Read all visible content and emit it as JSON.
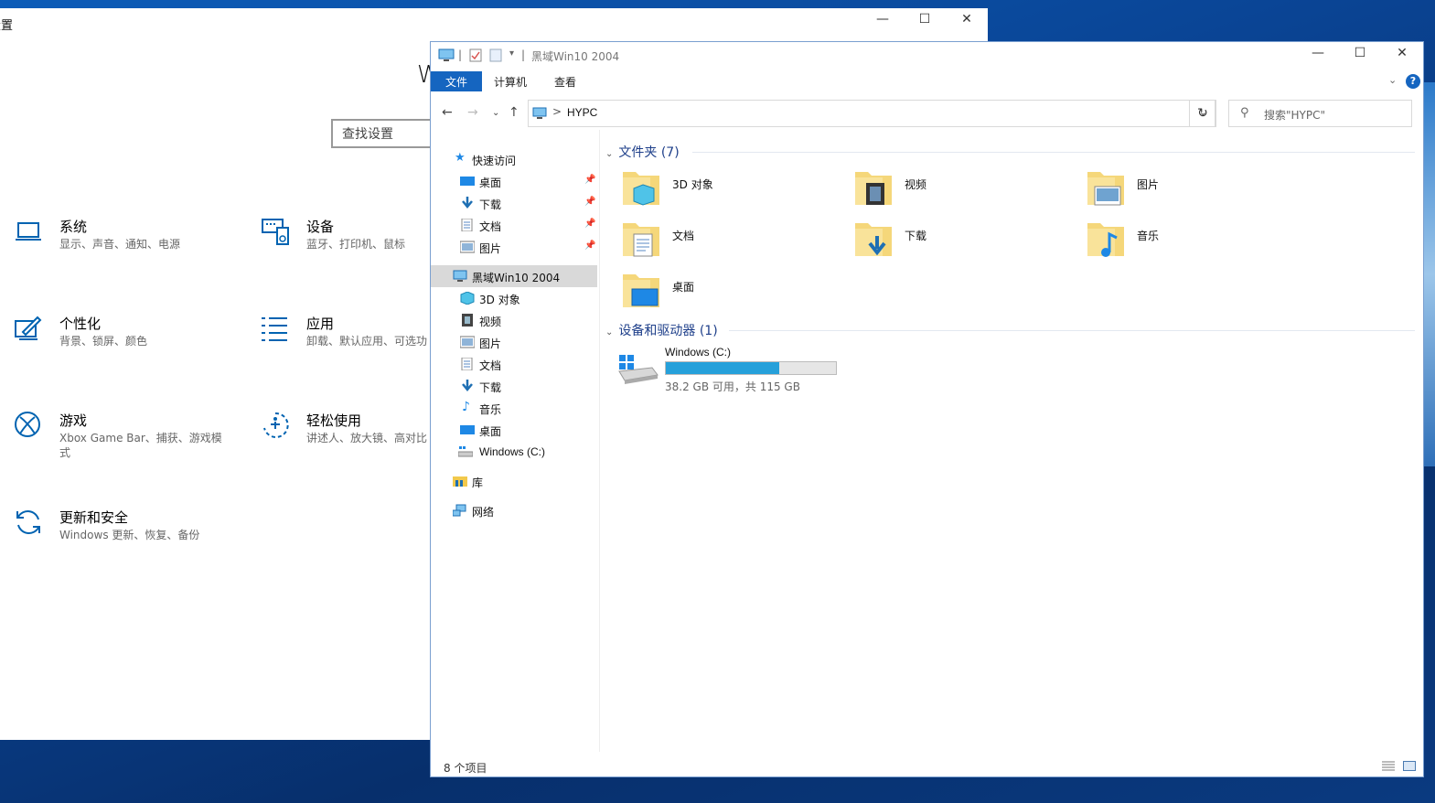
{
  "settings": {
    "title": "设置",
    "heading_partial": "W",
    "search_placeholder": "查找设置",
    "categories": [
      {
        "name": "系统",
        "desc": "显示、声音、通知、电源",
        "icon": "laptop-icon"
      },
      {
        "name": "设备",
        "desc": "蓝牙、打印机、鼠标",
        "icon": "keyboard-icon"
      },
      {
        "name": "个性化",
        "desc": "背景、锁屏、颜色",
        "icon": "paintbrush-icon"
      },
      {
        "name": "应用",
        "desc": "卸载、默认应用、可选功",
        "icon": "apps-list-icon"
      },
      {
        "name": "游戏",
        "desc": "Xbox Game Bar、捕获、游戏模式",
        "icon": "xbox-icon"
      },
      {
        "name": "轻松使用",
        "desc": "讲述人、放大镜、高对比",
        "icon": "ease-of-access-icon"
      },
      {
        "name": "更新和安全",
        "desc": "Windows 更新、恢复、备份",
        "icon": "sync-icon"
      }
    ]
  },
  "explorer": {
    "title": "黑域Win10 2004",
    "tabs": [
      "文件",
      "计算机",
      "查看"
    ],
    "address": {
      "path": "HYPC",
      "separator": ">"
    },
    "search_placeholder": "搜索\"HYPC\"",
    "nav": {
      "quick_access": "快速访问",
      "quick_items": [
        {
          "label": "桌面",
          "icon": "desktop-icon"
        },
        {
          "label": "下载",
          "icon": "download-icon"
        },
        {
          "label": "文档",
          "icon": "document-icon"
        },
        {
          "label": "图片",
          "icon": "pictures-icon"
        }
      ],
      "this_pc": "黑域Win10 2004",
      "pc_items": [
        {
          "label": "3D 对象",
          "icon": "3d-objects-icon"
        },
        {
          "label": "视频",
          "icon": "video-icon"
        },
        {
          "label": "图片",
          "icon": "pictures-icon"
        },
        {
          "label": "文档",
          "icon": "document-icon"
        },
        {
          "label": "下载",
          "icon": "download-icon"
        },
        {
          "label": "音乐",
          "icon": "music-icon"
        },
        {
          "label": "桌面",
          "icon": "desktop-icon"
        },
        {
          "label": "Windows (C:)",
          "icon": "drive-icon"
        }
      ],
      "libraries": "库",
      "network": "网络"
    },
    "folders_header": "文件夹 (7)",
    "folders": [
      {
        "label": "3D 对象",
        "icon": "3d-objects-folder-icon"
      },
      {
        "label": "视频",
        "icon": "video-folder-icon"
      },
      {
        "label": "图片",
        "icon": "pictures-folder-icon"
      },
      {
        "label": "文档",
        "icon": "documents-folder-icon"
      },
      {
        "label": "下载",
        "icon": "downloads-folder-icon"
      },
      {
        "label": "音乐",
        "icon": "music-folder-icon"
      },
      {
        "label": "桌面",
        "icon": "desktop-folder-icon"
      }
    ],
    "devices_header": "设备和驱动器 (1)",
    "drive": {
      "label": "Windows (C:)",
      "status": "38.2 GB 可用，共 115 GB",
      "used_fraction": 0.668,
      "bar_color": "#26a0da"
    },
    "status": "8 个项目"
  },
  "colors": {
    "accent": "#1565c0",
    "group_header": "#1e3f8a"
  }
}
